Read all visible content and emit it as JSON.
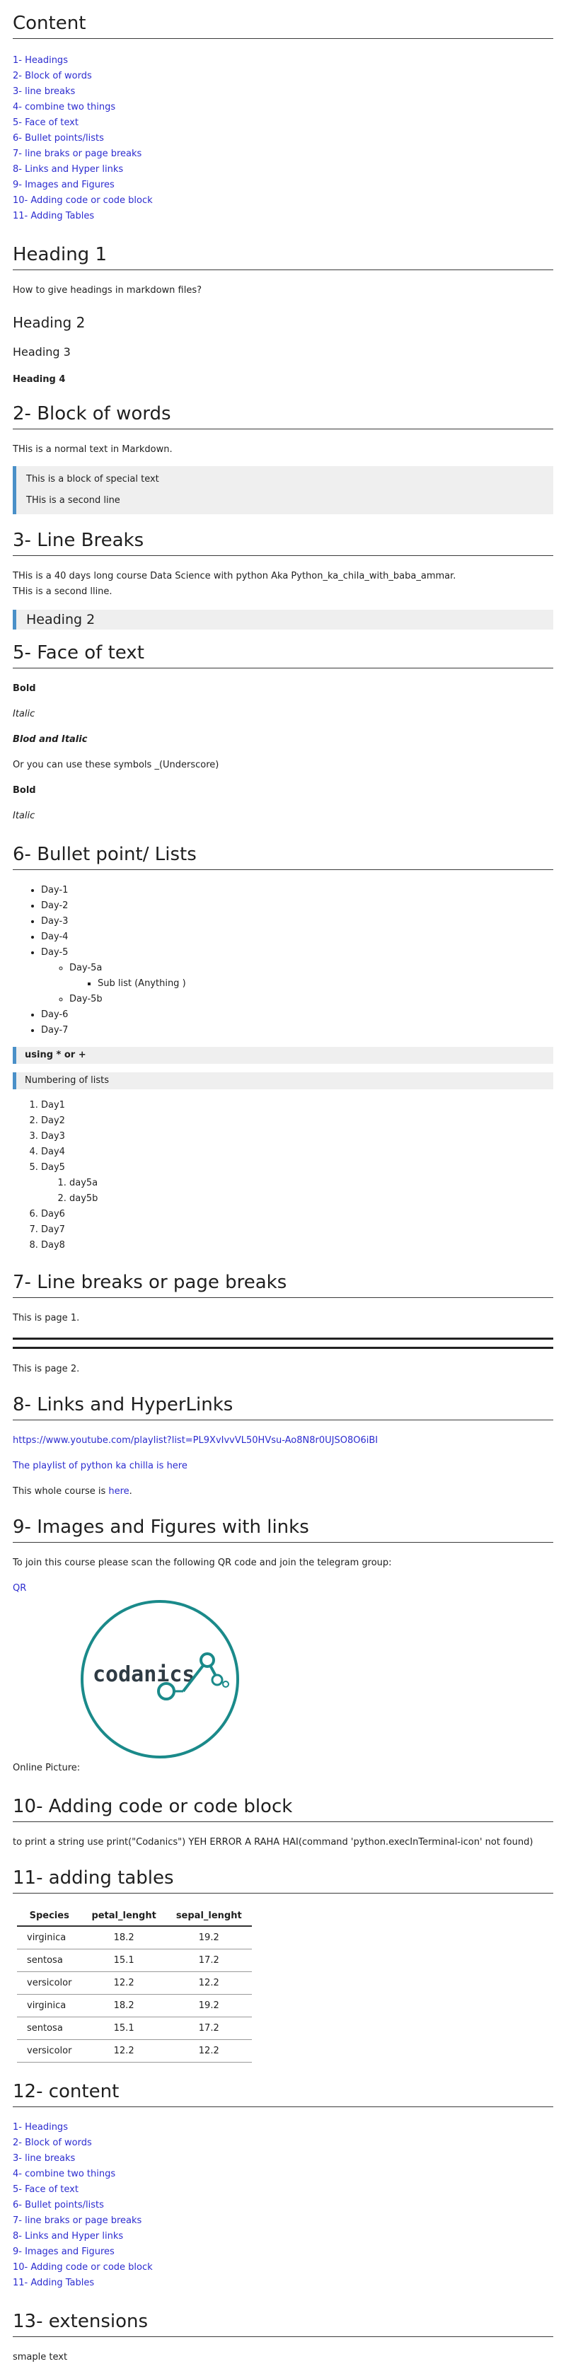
{
  "toc": {
    "title": "Content",
    "items": [
      "1- Headings",
      "2- Block of words",
      "3- line breaks",
      "4- combine two things",
      "5- Face of text",
      "6- Bullet points/lists",
      "7- line braks or page breaks",
      "8- Links and Hyper links",
      "9- Images and Figures",
      "10- Adding code or code block",
      "11- Adding Tables"
    ]
  },
  "headings": {
    "h1": "Heading 1",
    "question": "How to give headings in markdown files?",
    "h2": "Heading 2",
    "h3": "Heading 3",
    "h4": "Heading 4"
  },
  "block": {
    "title": "2- Block of words",
    "normal": "THis is a normal text in Markdown.",
    "quote1": "This is a block of special text",
    "quote2": "THis is a second line"
  },
  "breaks": {
    "title": "3- Line Breaks",
    "line1": "THis is a 40 days long course Data Science with python Aka Python_ka_chila_with_baba_ammar.",
    "line2": "THis is a second lline.",
    "quote_heading": "Heading 2"
  },
  "face": {
    "title": "5- Face of text",
    "bold": "Bold",
    "italic": "Italic",
    "bold_italic": "Blod and Italic",
    "underscore_note": "Or you can use these symbols _(Underscore)",
    "bold2": "Bold",
    "italic2": "Italic"
  },
  "bullets": {
    "title": "6- Bullet point/ Lists",
    "days_a": [
      "Day-1",
      "Day-2",
      "Day-3",
      "Day-4",
      "Day-5"
    ],
    "day5a": "Day-5a",
    "sublist": "Sub list (Anything )",
    "day5b": "Day-5b",
    "days_b": [
      "Day-6",
      "Day-7"
    ],
    "using_note": "using * or +",
    "numbering_note": "Numbering of lists",
    "num_a": [
      "Day1",
      "Day2",
      "Day3",
      "Day4",
      "Day5"
    ],
    "num_sub": [
      "day5a",
      "day5b"
    ],
    "num_b": [
      "Day6",
      "Day7",
      "Day8"
    ]
  },
  "pagebreaks": {
    "title": "7- Line breaks or page breaks",
    "page1": "This is page 1.",
    "page2": "This is page 2."
  },
  "links": {
    "title": "8- Links and HyperLinks",
    "url": "https://www.youtube.com/playlist?list=PL9XvIvvVL50HVsu-Ao8N8r0UJSO8O6iBI",
    "playlist": "The playlist of python ka chilla is here",
    "whole_prefix": "This whole course is ",
    "here": "here",
    "whole_suffix": "."
  },
  "images": {
    "title": "9- Images and Figures with links",
    "instruction": "To join this course please scan the following QR code and join the telegram group:",
    "qr": "QR",
    "logo_text": "codanics",
    "online": "Online Picture:"
  },
  "code": {
    "title": "10- Adding code or code block",
    "text": "to print a string use print(\"Codanics\") YEH ERROR A RAHA HAI(command 'python.execInTerminal-icon' not found)"
  },
  "tables": {
    "title": "11- adding tables",
    "headers": [
      "Species",
      "petal_lenght",
      "sepal_lenght"
    ],
    "rows": [
      [
        "virginica",
        "18.2",
        "19.2"
      ],
      [
        "sentosa",
        "15.1",
        "17.2"
      ],
      [
        "versicolor",
        "12.2",
        "12.2"
      ],
      [
        "virginica",
        "18.2",
        "19.2"
      ],
      [
        "sentosa",
        "15.1",
        "17.2"
      ],
      [
        "versicolor",
        "12.2",
        "12.2"
      ]
    ]
  },
  "content2": {
    "title": "12- content",
    "items": [
      "1- Headings",
      "2- Block of words",
      "3- line breaks",
      "4- combine two things",
      "5- Face of text",
      "6- Bullet points/lists",
      "7- line braks or page breaks",
      "8- Links and Hyper links",
      "9- Images and Figures",
      "10- Adding code or code block",
      "11- Adding Tables"
    ]
  },
  "extensions": {
    "title": "13- extensions",
    "sample": "smaple text"
  },
  "colors": {
    "link": "#2c2ccf",
    "quote_border": "#4a90c8",
    "quote_bg": "#efefef",
    "logo_teal": "#1a8a8a"
  }
}
